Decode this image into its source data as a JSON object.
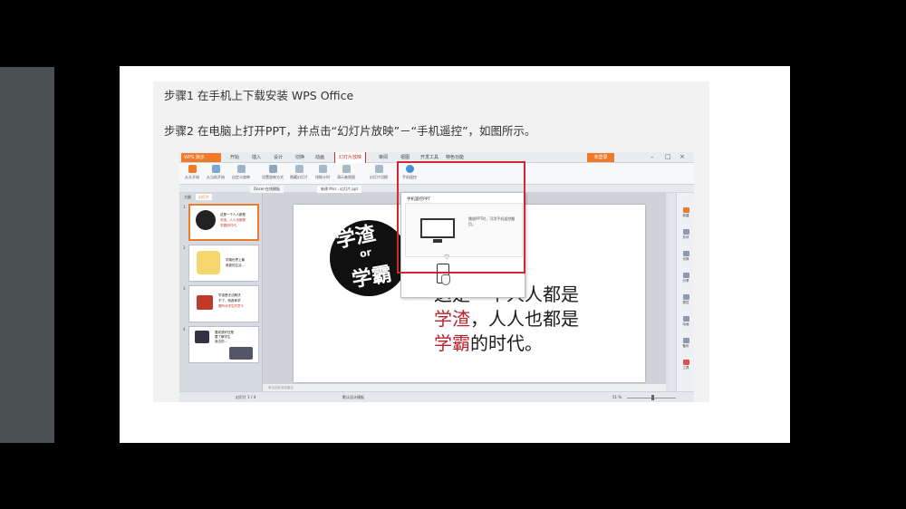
{
  "document": {
    "step1": "步骤1 在手机上下载安装 WPS Office",
    "step2": "步骤2 在电脑上打开PPT，并点击“幻灯片放映”－“手机遥控”，如图所示。"
  },
  "wps": {
    "app_button": "WPS 演示",
    "menu_tabs": [
      "开始",
      "插入",
      "设计",
      "切换",
      "动画",
      "幻灯片放映",
      "审阅",
      "视图",
      "开发工具",
      "特色功能"
    ],
    "active_menu": "幻灯片放映",
    "login": "未登录",
    "ribbon_buttons": [
      "从头开始",
      "从当前开始",
      "自定义放映",
      "设置放映方式",
      "隐藏幻灯片",
      "排练计时",
      "演示者视图",
      "幻灯片切换",
      "手机遥控"
    ],
    "doc_tabs": [
      "Docer-在线模板",
      "新建 Micr...幻灯片.ppt"
    ],
    "panel_tabs": [
      "大纲",
      "幻灯片"
    ],
    "thumbnails": [
      {
        "num": "1",
        "lines": [
          "这是一个人人都是",
          "学渣，人人也都是",
          "学霸的时代。"
        ]
      },
      {
        "num": "2",
        "lines": [
          "学霸世界上最",
          "难被的生活..."
        ]
      },
      {
        "num": "3",
        "lines": [
          "学渣是无法解决",
          "不了，而各种学",
          "霸所对学生的意义"
        ]
      },
      {
        "num": "4",
        "lines": [
          "要成绩好还是",
          "要了解学生",
          "身边的..."
        ]
      }
    ],
    "slide": {
      "logo_top": "学渣",
      "logo_mid": "or",
      "logo_bottom": "学霸",
      "line1": "这是一个人人都是",
      "line2_red": "学渣",
      "line2_rest": "，人人也都是",
      "line3_red": "学霸",
      "line3_rest": "的时代。"
    },
    "popup": {
      "title": "手机遥控PPT",
      "description": "播放PPT时，可用手机遥控翻页。"
    },
    "right_bar": [
      "新建",
      "形状",
      "切换",
      "分享",
      "属性",
      "动画",
      "备份",
      "工具"
    ],
    "notes_placeholder": "单击此处添加备注",
    "status": {
      "slide_info": "幻灯片 1 / 4",
      "theme": "默认设计模板",
      "zoom": "51 %"
    }
  }
}
